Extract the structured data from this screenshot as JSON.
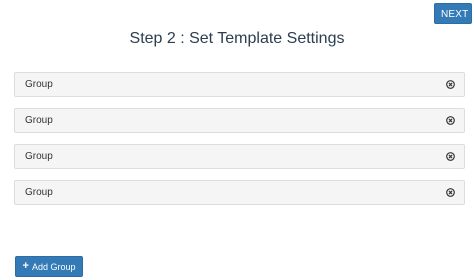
{
  "header": {
    "next_label": "NEXT",
    "title": "Step 2 : Set Template Settings"
  },
  "groups": [
    {
      "label": "Group",
      "remove_icon": "remove-circle-icon"
    },
    {
      "label": "Group",
      "remove_icon": "remove-circle-icon"
    },
    {
      "label": "Group",
      "remove_icon": "remove-circle-icon"
    },
    {
      "label": "Group",
      "remove_icon": "remove-circle-icon"
    }
  ],
  "footer": {
    "add_group_label": "Add Group",
    "add_group_icon": "plus-icon"
  },
  "colors": {
    "primary": "#337ab7",
    "title": "#2c3e50",
    "row_background": "#f5f5f5",
    "row_border": "#dddddd"
  }
}
